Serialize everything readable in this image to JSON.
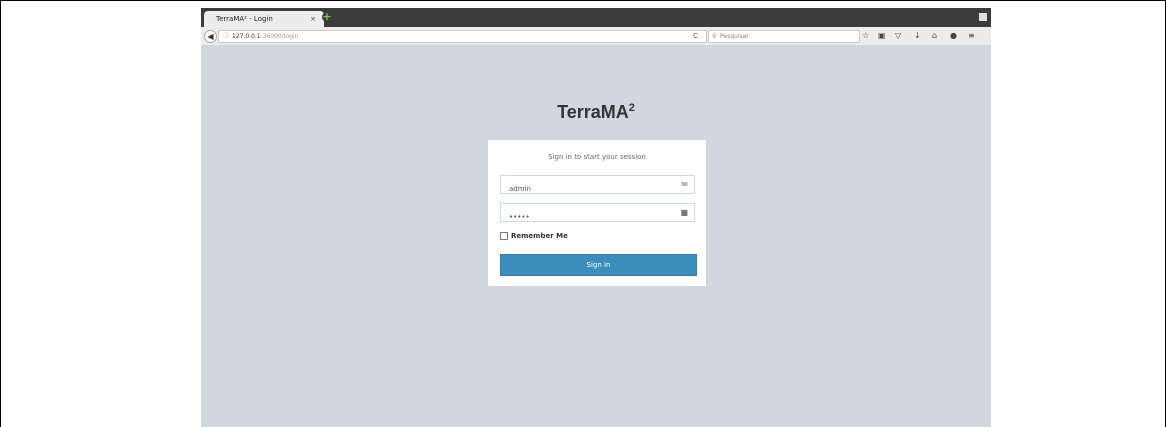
{
  "browser": {
    "tab": {
      "title": "TerraMA² - Login",
      "close": "×"
    },
    "new_tab": "+",
    "url": {
      "host": "127.0.0.1",
      "path": ":36000/login"
    },
    "reload": "C",
    "search": {
      "placeholder": "Pesquisar"
    },
    "toolbar_icons": [
      "bookmark-star-icon",
      "reading-list-icon",
      "pocket-icon",
      "download-icon",
      "home-icon",
      "chat-icon",
      "menu-icon"
    ]
  },
  "page": {
    "logo_text": "TerraMA",
    "logo_sup": "2",
    "login_box_msg": "Sign in to start your session",
    "username": {
      "value": "admin"
    },
    "password": {
      "value": "•••••"
    },
    "remember_label": "Remember Me",
    "signin_label": "Sign In"
  },
  "colors": {
    "background": "#d2d6de",
    "button": "#3c8dbc"
  }
}
